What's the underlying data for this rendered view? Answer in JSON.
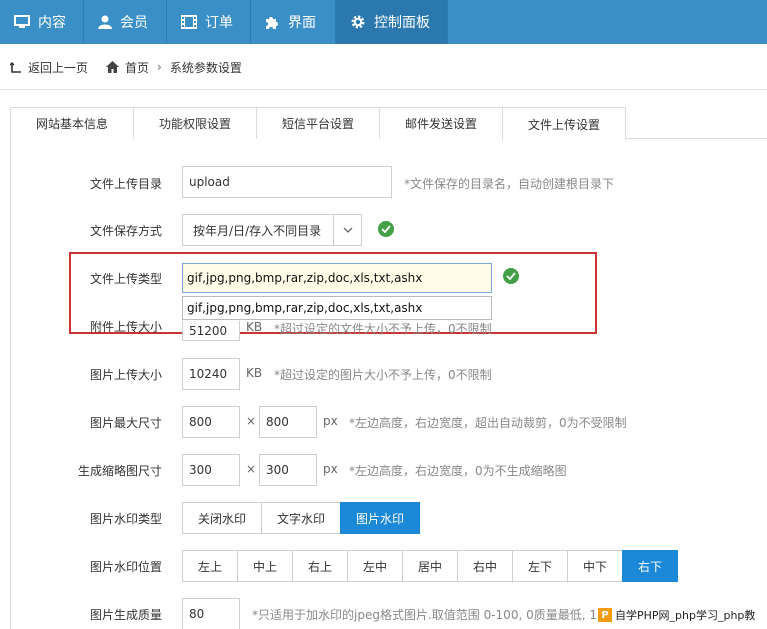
{
  "nav": {
    "items": [
      {
        "label": "内容",
        "icon": "monitor-icon"
      },
      {
        "label": "会员",
        "icon": "user-icon"
      },
      {
        "label": "订单",
        "icon": "film-icon"
      },
      {
        "label": "界面",
        "icon": "puzzle-icon"
      },
      {
        "label": "控制面板",
        "icon": "gear-icon",
        "active": true
      }
    ],
    "color": "#3a8fc7"
  },
  "breadcrumb": {
    "back": "返回上一页",
    "home": "首页",
    "current": "系统参数设置"
  },
  "tabs": [
    "网站基本信息",
    "功能权限设置",
    "短信平台设置",
    "邮件发送设置",
    "文件上传设置"
  ],
  "active_tab": "文件上传设置",
  "form": {
    "upload_dir": {
      "label": "文件上传目录",
      "value": "upload",
      "hint": "*文件保存的目录名，自动创建根目录下"
    },
    "save_mode": {
      "label": "文件保存方式",
      "value": "按年月/日/存入不同目录"
    },
    "file_types": {
      "label": "文件上传类型",
      "value": "gif,jpg,png,bmp,rar,zip,doc,xls,txt,ashx",
      "suggestion": "gif,jpg,png,bmp,rar,zip,doc,xls,txt,ashx"
    },
    "attach_size": {
      "label": "附件上传大小",
      "value": "51200",
      "unit": "KB",
      "hint": "*超过设定的文件大小不予上传，0不限制"
    },
    "image_size": {
      "label": "图片上传大小",
      "value": "10240",
      "unit": "KB",
      "hint": "*超过设定的图片大小不予上传，0不限制"
    },
    "image_max": {
      "label": "图片最大尺寸",
      "height": "800",
      "times": "×",
      "width": "800",
      "unit": "px",
      "hint": "*左边高度，右边宽度，超出自动裁剪，0为不受限制"
    },
    "thumb": {
      "label": "生成缩略图尺寸",
      "height": "300",
      "times": "×",
      "width": "300",
      "unit": "px",
      "hint": "*左边高度，右边宽度，0为不生成缩略图"
    },
    "watermark_type": {
      "label": "图片水印类型",
      "options": [
        "关闭水印",
        "文字水印",
        "图片水印"
      ],
      "selected": "图片水印"
    },
    "watermark_pos": {
      "label": "图片水印位置",
      "options": [
        "左上",
        "中上",
        "右上",
        "左中",
        "居中",
        "右中",
        "左下",
        "中下",
        "右下"
      ],
      "selected": "右下"
    },
    "quality": {
      "label": "图片生成质量",
      "value": "80",
      "hint": "*只适用于加水印的jpeg格式图片.取值范围 0-100, 0质量最低, 10"
    }
  },
  "watermark": {
    "text": "自学PHP网_php学习_php教"
  },
  "colors": {
    "accent": "#1c88d8",
    "check": "#43a047",
    "highlight": "#c33"
  }
}
